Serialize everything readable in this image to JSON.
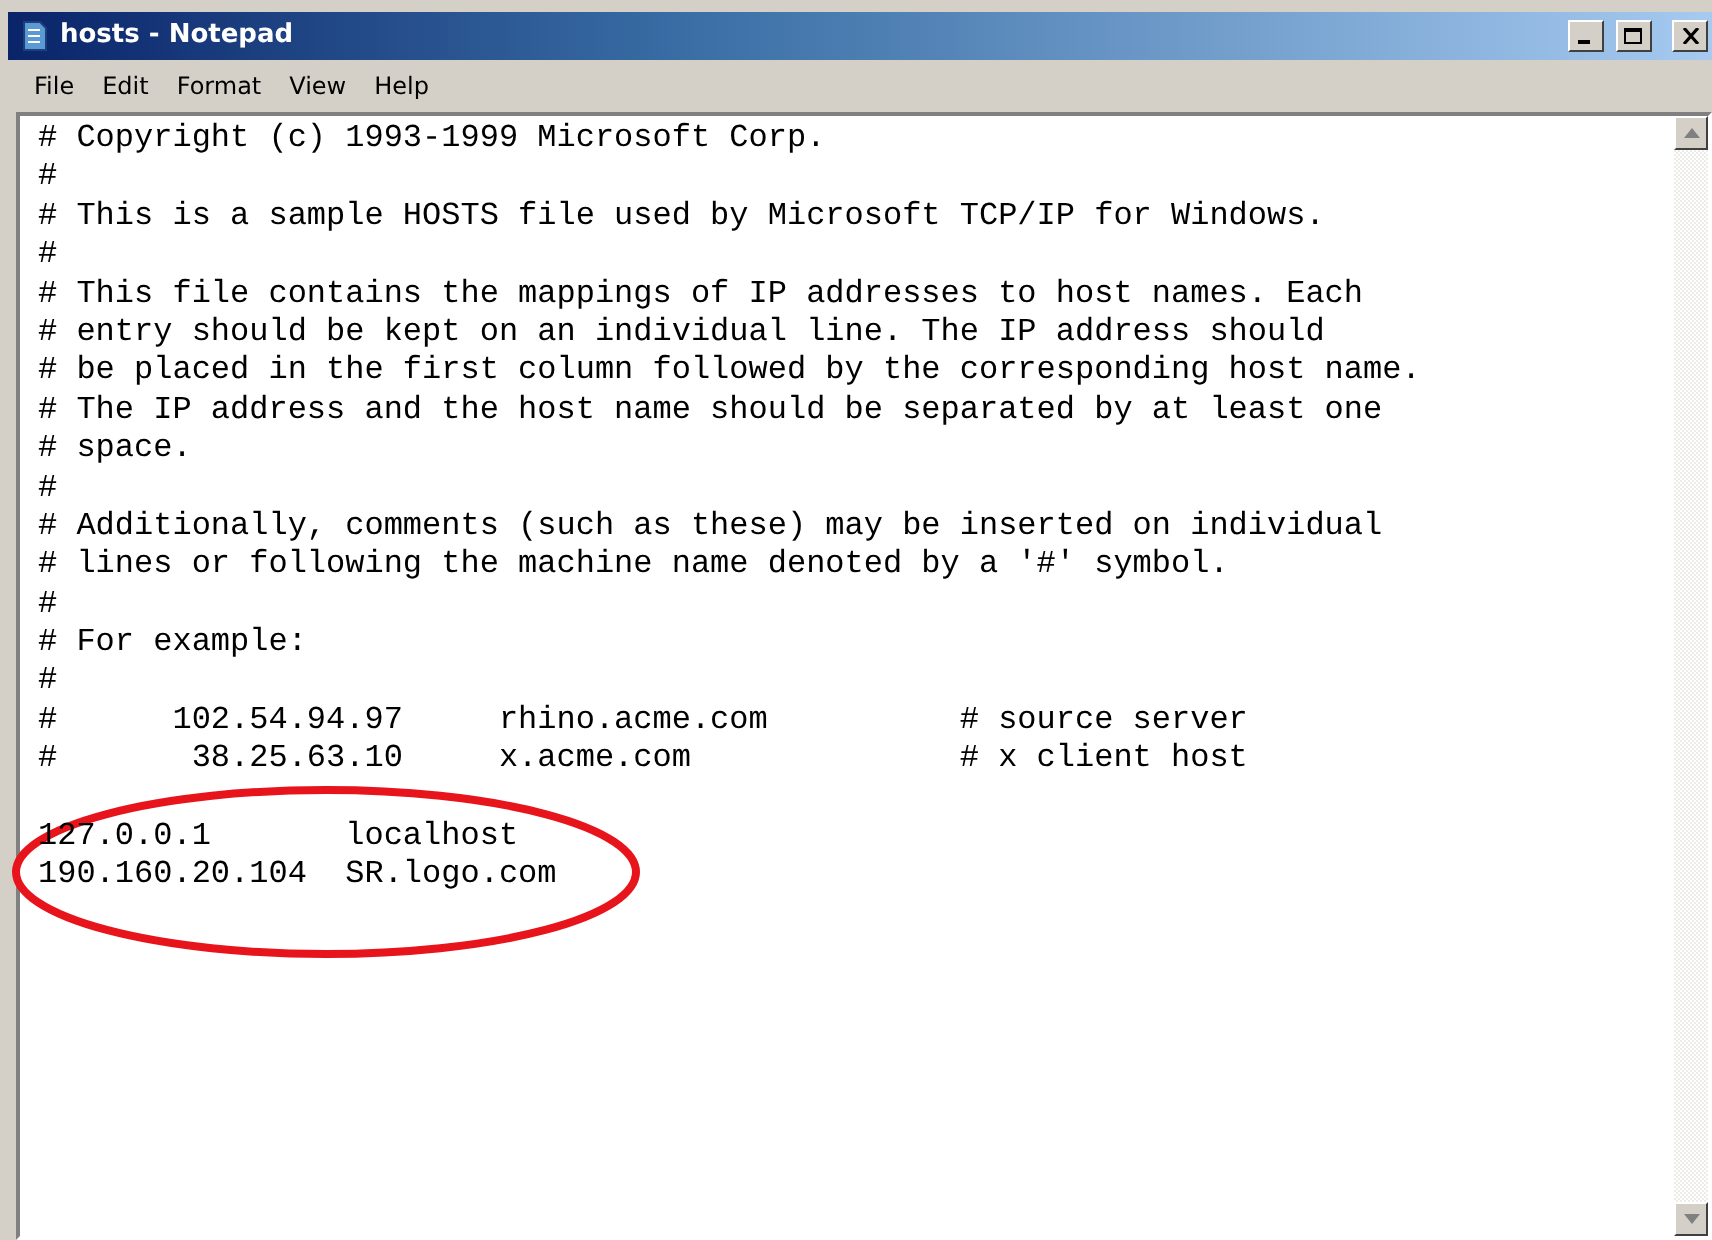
{
  "window": {
    "title": "hosts - Notepad"
  },
  "menu": [
    "File",
    "Edit",
    "Format",
    "View",
    "Help"
  ],
  "editor": {
    "lines": [
      {
        "kind": "text",
        "text": "# Copyright (c) 1993-1999 Microsoft Corp."
      },
      {
        "kind": "text",
        "text": "#"
      },
      {
        "kind": "text",
        "text": "# This is a sample HOSTS file used by Microsoft TCP/IP for Windows."
      },
      {
        "kind": "text",
        "text": "#"
      },
      {
        "kind": "text",
        "text": "# This file contains the mappings of IP addresses to host names. Each"
      },
      {
        "kind": "text",
        "text": "# entry should be kept on an individual line. The IP address should"
      },
      {
        "kind": "text",
        "text": "# be placed in the first column followed by the corresponding host name."
      },
      {
        "kind": "text",
        "text": "# The IP address and the host name should be separated by at least one"
      },
      {
        "kind": "text",
        "text": "# space."
      },
      {
        "kind": "text",
        "text": "#"
      },
      {
        "kind": "text",
        "text": "# Additionally, comments (such as these) may be inserted on individual"
      },
      {
        "kind": "text",
        "text": "# lines or following the machine name denoted by a '#' symbol."
      },
      {
        "kind": "text",
        "text": "#"
      },
      {
        "kind": "text",
        "text": "# For example:"
      },
      {
        "kind": "text",
        "text": "#"
      },
      {
        "kind": "text",
        "text": "#      102.54.94.97     rhino.acme.com          # source server"
      },
      {
        "kind": "text",
        "text": "#       38.25.63.10     x.acme.com              # x client host"
      },
      {
        "kind": "blank"
      },
      {
        "kind": "text",
        "text": "127.0.0.1       localhost"
      },
      {
        "kind": "text",
        "text": "190.160.20.104  SR.logo.com"
      }
    ]
  },
  "annotation": {
    "kind": "ellipse"
  }
}
